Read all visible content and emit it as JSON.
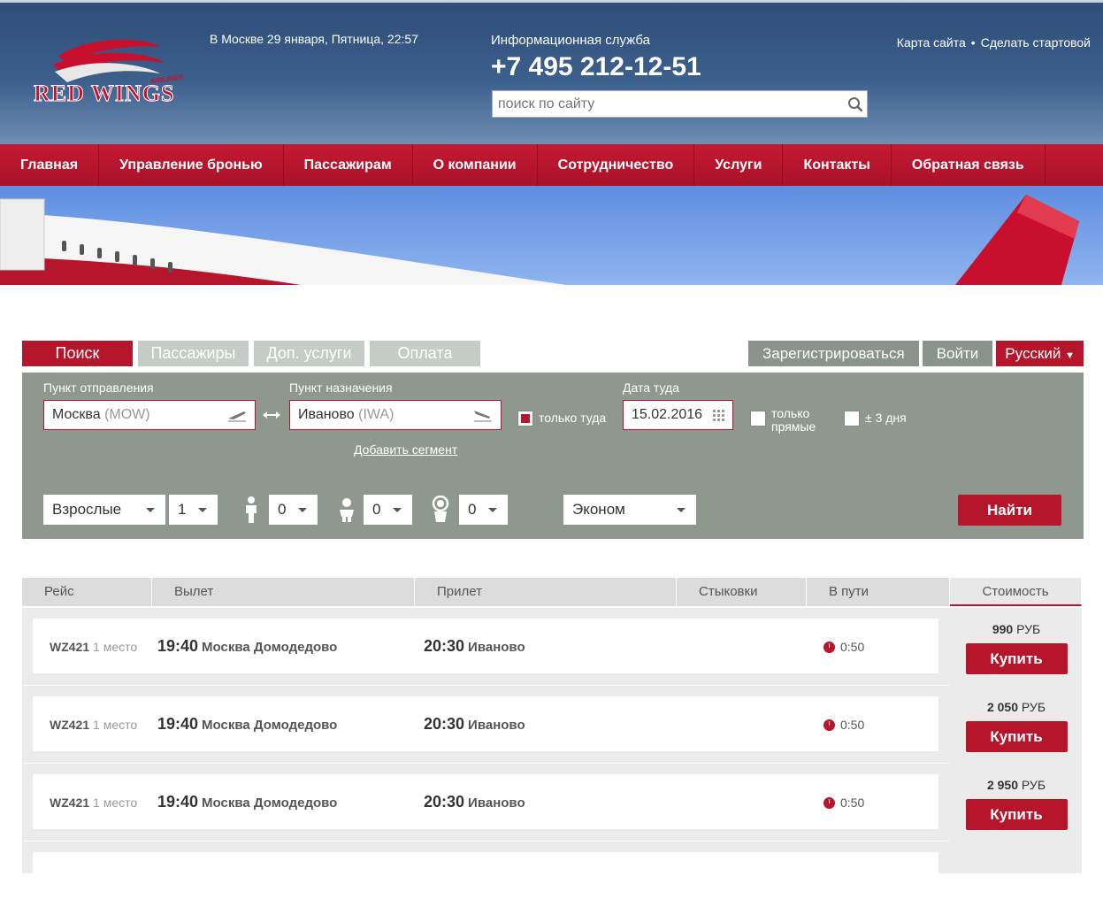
{
  "header": {
    "logo_text": "RED WINGS",
    "logo_sub": "AIRLINES",
    "datetime": "В Москве 29 января, Пятница, 22:57",
    "info_label": "Информационная служба",
    "phone": "+7 495 212-12-51",
    "search_placeholder": "поиск по сайту",
    "links": {
      "sitemap": "Карта сайта",
      "dot": "•",
      "homepage": "Сделать стартовой"
    }
  },
  "nav": [
    "Главная",
    "Управление бронью",
    "Пассажирам",
    "О компании",
    "Сотрудничество",
    "Услуги",
    "Контакты",
    "Обратная связь"
  ],
  "tabs": [
    "Поиск",
    "Пассажиры",
    "Доп. услуги",
    "Оплата"
  ],
  "account": {
    "register": "Зарегистрироваться",
    "login": "Войти",
    "language": "Русский"
  },
  "search": {
    "from_label": "Пункт отправления",
    "from_city": "Москва",
    "from_code": "(MOW)",
    "to_label": "Пункт назначения",
    "to_city": "Иваново",
    "to_code": "(IWA)",
    "one_way": "только туда",
    "date_label": "Дата туда",
    "date": "15.02.2016",
    "direct_1": "только",
    "direct_2": "прямые",
    "flex": "± 3 дня",
    "add_segment": "Добавить сегмент",
    "pax_type": "Взрослые",
    "adults": "1",
    "children": "0",
    "infants": "0",
    "infants_seat": "0",
    "cabin": "Эконом",
    "find": "Найти"
  },
  "results": {
    "columns": [
      "Рейс",
      "Вылет",
      "Прилет",
      "Стыковки",
      "В пути",
      "Стоимость"
    ],
    "rows": [
      {
        "flight": "WZ421",
        "seats": "1 место",
        "dep_time": "19:40",
        "dep_city": "Москва Домодедово",
        "arr_time": "20:30",
        "arr_city": "Иваново",
        "duration": "0:50",
        "price": "990",
        "currency": "РУБ",
        "buy": "Купить"
      },
      {
        "flight": "WZ421",
        "seats": "1 место",
        "dep_time": "19:40",
        "dep_city": "Москва Домодедово",
        "arr_time": "20:30",
        "arr_city": "Иваново",
        "duration": "0:50",
        "price": "2 050",
        "currency": "РУБ",
        "buy": "Купить"
      },
      {
        "flight": "WZ421",
        "seats": "1 место",
        "dep_time": "19:40",
        "dep_city": "Москва Домодедово",
        "arr_time": "20:30",
        "arr_city": "Иваново",
        "duration": "0:50",
        "price": "2 950",
        "currency": "РУБ",
        "buy": "Купить"
      }
    ]
  },
  "colors": {
    "brand_red": "#b5162c",
    "header_blue": "#3c5f8c",
    "panel_gray": "#8e988f"
  }
}
